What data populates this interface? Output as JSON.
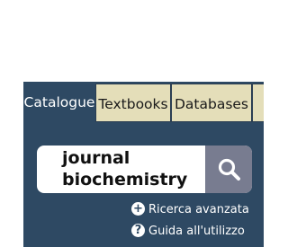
{
  "tabs": [
    {
      "label": "Catalogue",
      "active": true
    },
    {
      "label": "Textbooks",
      "active": false
    },
    {
      "label": "Databases",
      "active": false
    }
  ],
  "search": {
    "value": "journal\nbiochemistry",
    "button_icon": "search-icon"
  },
  "links": {
    "advanced_search": "Ricerca avanzata",
    "advanced_search_icon": "plus-circle-icon",
    "user_guide": "Guida all'utilizzo",
    "user_guide_icon": "question-circle-icon"
  },
  "colors": {
    "panel": "#2e4963",
    "inactive_tab": "#e4deb9",
    "search_button": "#787c90"
  }
}
